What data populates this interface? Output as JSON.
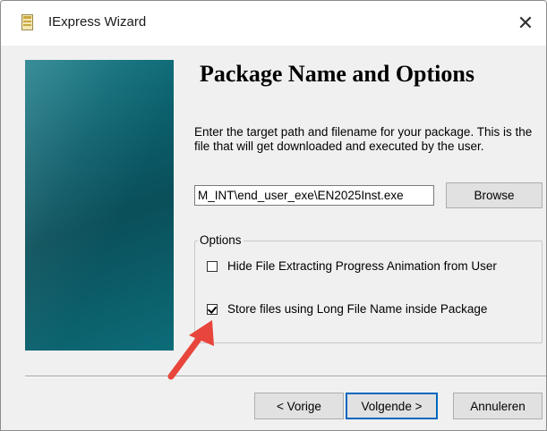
{
  "window": {
    "title": "IExpress Wizard",
    "close_glyph": "✕"
  },
  "page": {
    "heading": "Package Name and Options",
    "description": "Enter the target path and filename for your package. This is the file that will get downloaded and executed by the user."
  },
  "path_field": {
    "value": "M_INT\\end_user_exe\\EN2025Inst.exe"
  },
  "buttons": {
    "browse": "Browse",
    "back": "< Vorige",
    "next": "Volgende >",
    "cancel": "Annuleren"
  },
  "options": {
    "legend": "Options",
    "items": [
      {
        "label": "Hide File Extracting Progress Animation from User",
        "checked": false
      },
      {
        "label": "Store files using Long File Name inside Package",
        "checked": true
      }
    ]
  },
  "colors": {
    "banner": "#0b5f6c",
    "arrow": "#e8453c",
    "default_button_border": "#0067c0"
  },
  "icons": {
    "app": "iexpress-app-icon",
    "close": "close-icon",
    "annotation": "red-arrow-icon"
  }
}
